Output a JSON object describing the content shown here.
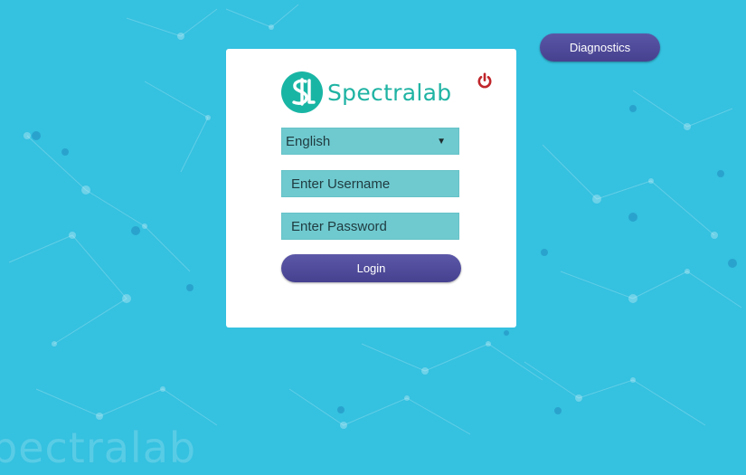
{
  "app": {
    "brand_name": "Spectralab",
    "watermark_text": "pectralab",
    "background_color": "#35c1e0"
  },
  "header": {
    "diagnostics_label": "Diagnostics"
  },
  "login_card": {
    "logo_mark_letters": "SL",
    "power_icon": "power-icon",
    "language": {
      "selected": "English"
    },
    "username": {
      "placeholder": "Enter Username",
      "value": ""
    },
    "password": {
      "placeholder": "Enter Password",
      "value": ""
    },
    "login_label": "Login"
  },
  "colors": {
    "accent_teal": "#1fb3a3",
    "button_purple": "#4c479a",
    "field_teal": "#6fcacf",
    "power_red": "#c0262b"
  }
}
